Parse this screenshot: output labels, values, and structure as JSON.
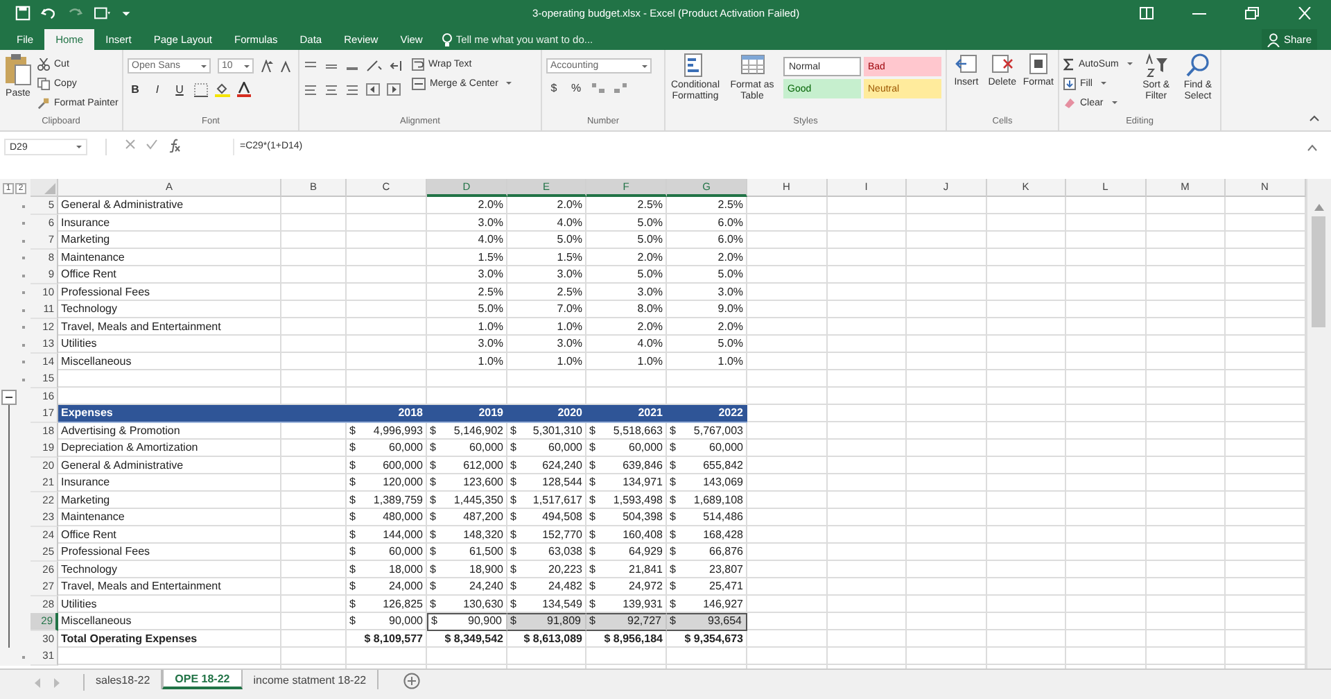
{
  "title_bar": {
    "title": "3-operating budget.xlsx - Excel (Product Activation Failed)"
  },
  "menu_tabs": [
    {
      "label": "File",
      "selected": false
    },
    {
      "label": "Home",
      "selected": true
    },
    {
      "label": "Insert",
      "selected": false
    },
    {
      "label": "Page Layout",
      "selected": false
    },
    {
      "label": "Formulas",
      "selected": false
    },
    {
      "label": "Data",
      "selected": false
    },
    {
      "label": "Review",
      "selected": false
    },
    {
      "label": "View",
      "selected": false
    }
  ],
  "tell_me": {
    "placeholder": "Tell me what you want to do..."
  },
  "share": "Share",
  "ribbon": {
    "clipboard": {
      "label": "Clipboard",
      "paste": "Paste",
      "cut": "Cut",
      "copy": "Copy",
      "format_painter": "Format Painter"
    },
    "font": {
      "label": "Font",
      "family": "Open Sans",
      "size": "10",
      "bold": "B",
      "italic": "I",
      "underline": "U"
    },
    "alignment": {
      "label": "Alignment",
      "wrap_text": "Wrap Text",
      "merge_center": "Merge & Center"
    },
    "number": {
      "label": "Number",
      "format": "Accounting",
      "currency": "$",
      "percent": "%"
    },
    "styles": {
      "label": "Styles",
      "conditional_formatting": "Conditional Formatting",
      "format_as_table": "Format as Table",
      "cell_styles": [
        {
          "label": "Normal",
          "kind": "normal"
        },
        {
          "label": "Bad",
          "kind": "bad"
        },
        {
          "label": "Good",
          "kind": "good"
        },
        {
          "label": "Neutral",
          "kind": "neutral"
        }
      ]
    },
    "cells": {
      "label": "Cells",
      "insert": "Insert",
      "delete": "Delete",
      "format": "Format"
    },
    "editing": {
      "label": "Editing",
      "autosum": "AutoSum",
      "fill": "Fill",
      "clear": "Clear",
      "sort_filter": "Sort & Filter",
      "find_select": "Find & Select"
    }
  },
  "formula_bar": {
    "name_box": "D29",
    "formula": "=C29*(1+D14)"
  },
  "outline": {
    "levels": [
      "1",
      "2"
    ],
    "expanded": true
  },
  "columns": [
    {
      "label": "A",
      "selected": false
    },
    {
      "label": "B",
      "selected": false
    },
    {
      "label": "C",
      "selected": false
    },
    {
      "label": "D",
      "selected": true
    },
    {
      "label": "E",
      "selected": true
    },
    {
      "label": "F",
      "selected": true
    },
    {
      "label": "G",
      "selected": true
    },
    {
      "label": "H",
      "selected": false
    },
    {
      "label": "I",
      "selected": false
    },
    {
      "label": "J",
      "selected": false
    },
    {
      "label": "K",
      "selected": false
    },
    {
      "label": "L",
      "selected": false
    },
    {
      "label": "M",
      "selected": false
    },
    {
      "label": "N",
      "selected": false
    }
  ],
  "rows": [
    {
      "number": "5",
      "kind": "rate",
      "grouped": false,
      "selected": false,
      "label": "General & Administrative",
      "values": [
        "2.0%",
        "2.0%",
        "2.5%",
        "2.5%"
      ]
    },
    {
      "number": "6",
      "kind": "rate",
      "grouped": false,
      "selected": false,
      "label": "Insurance",
      "values": [
        "3.0%",
        "4.0%",
        "5.0%",
        "6.0%"
      ]
    },
    {
      "number": "7",
      "kind": "rate",
      "grouped": false,
      "selected": false,
      "label": "Marketing",
      "values": [
        "4.0%",
        "5.0%",
        "5.0%",
        "6.0%"
      ]
    },
    {
      "number": "8",
      "kind": "rate",
      "grouped": false,
      "selected": false,
      "label": "Maintenance",
      "values": [
        "1.5%",
        "1.5%",
        "2.0%",
        "2.0%"
      ]
    },
    {
      "number": "9",
      "kind": "rate",
      "grouped": false,
      "selected": false,
      "label": "Office Rent",
      "values": [
        "3.0%",
        "3.0%",
        "5.0%",
        "5.0%"
      ]
    },
    {
      "number": "10",
      "kind": "rate",
      "grouped": false,
      "selected": false,
      "label": "Professional Fees",
      "values": [
        "2.5%",
        "2.5%",
        "3.0%",
        "3.0%"
      ]
    },
    {
      "number": "11",
      "kind": "rate",
      "grouped": false,
      "selected": false,
      "label": "Technology",
      "values": [
        "5.0%",
        "7.0%",
        "8.0%",
        "9.0%"
      ]
    },
    {
      "number": "12",
      "kind": "rate",
      "grouped": false,
      "selected": false,
      "label": "Travel, Meals and Entertainment",
      "values": [
        "1.0%",
        "1.0%",
        "2.0%",
        "2.0%"
      ]
    },
    {
      "number": "13",
      "kind": "rate",
      "grouped": false,
      "selected": false,
      "label": "Utilities",
      "values": [
        "3.0%",
        "3.0%",
        "4.0%",
        "5.0%"
      ]
    },
    {
      "number": "14",
      "kind": "rate",
      "grouped": false,
      "selected": false,
      "label": "Miscellaneous",
      "values": [
        "1.0%",
        "1.0%",
        "1.0%",
        "1.0%"
      ]
    },
    {
      "number": "15",
      "kind": "empty",
      "grouped": false,
      "selected": false
    },
    {
      "number": "16",
      "kind": "empty",
      "grouped": false,
      "selected": false
    },
    {
      "number": "17",
      "kind": "header",
      "grouped": true,
      "selected": false,
      "label": "Expenses",
      "values": [
        "2018",
        "2019",
        "2020",
        "2021",
        "2022"
      ]
    },
    {
      "number": "18",
      "kind": "amount",
      "grouped": true,
      "selected": false,
      "label": "Advertising & Promotion",
      "cells": [
        {
          "symbol": "$",
          "amount": "4,996,993",
          "selected": false
        },
        {
          "symbol": "$",
          "amount": "5,146,902",
          "selected": false
        },
        {
          "symbol": "$",
          "amount": "5,301,310",
          "selected": false
        },
        {
          "symbol": "$",
          "amount": "5,518,663",
          "selected": false
        },
        {
          "symbol": "$",
          "amount": "5,767,003",
          "selected": false
        }
      ]
    },
    {
      "number": "19",
      "kind": "amount",
      "grouped": true,
      "selected": false,
      "label": "Depreciation & Amortization",
      "cells": [
        {
          "symbol": "$",
          "amount": "60,000",
          "selected": false
        },
        {
          "symbol": "$",
          "amount": "60,000",
          "selected": false
        },
        {
          "symbol": "$",
          "amount": "60,000",
          "selected": false
        },
        {
          "symbol": "$",
          "amount": "60,000",
          "selected": false
        },
        {
          "symbol": "$",
          "amount": "60,000",
          "selected": false
        }
      ]
    },
    {
      "number": "20",
      "kind": "amount",
      "grouped": true,
      "selected": false,
      "label": "General & Administrative",
      "cells": [
        {
          "symbol": "$",
          "amount": "600,000",
          "selected": false
        },
        {
          "symbol": "$",
          "amount": "612,000",
          "selected": false
        },
        {
          "symbol": "$",
          "amount": "624,240",
          "selected": false
        },
        {
          "symbol": "$",
          "amount": "639,846",
          "selected": false
        },
        {
          "symbol": "$",
          "amount": "655,842",
          "selected": false
        }
      ]
    },
    {
      "number": "21",
      "kind": "amount",
      "grouped": true,
      "selected": false,
      "label": "Insurance",
      "cells": [
        {
          "symbol": "$",
          "amount": "120,000",
          "selected": false
        },
        {
          "symbol": "$",
          "amount": "123,600",
          "selected": false
        },
        {
          "symbol": "$",
          "amount": "128,544",
          "selected": false
        },
        {
          "symbol": "$",
          "amount": "134,971",
          "selected": false
        },
        {
          "symbol": "$",
          "amount": "143,069",
          "selected": false
        }
      ]
    },
    {
      "number": "22",
      "kind": "amount",
      "grouped": true,
      "selected": false,
      "label": "Marketing",
      "cells": [
        {
          "symbol": "$",
          "amount": "1,389,759",
          "selected": false
        },
        {
          "symbol": "$",
          "amount": "1,445,350",
          "selected": false
        },
        {
          "symbol": "$",
          "amount": "1,517,617",
          "selected": false
        },
        {
          "symbol": "$",
          "amount": "1,593,498",
          "selected": false
        },
        {
          "symbol": "$",
          "amount": "1,689,108",
          "selected": false
        }
      ]
    },
    {
      "number": "23",
      "kind": "amount",
      "grouped": true,
      "selected": false,
      "label": "Maintenance",
      "cells": [
        {
          "symbol": "$",
          "amount": "480,000",
          "selected": false
        },
        {
          "symbol": "$",
          "amount": "487,200",
          "selected": false
        },
        {
          "symbol": "$",
          "amount": "494,508",
          "selected": false
        },
        {
          "symbol": "$",
          "amount": "504,398",
          "selected": false
        },
        {
          "symbol": "$",
          "amount": "514,486",
          "selected": false
        }
      ]
    },
    {
      "number": "24",
      "kind": "amount",
      "grouped": true,
      "selected": false,
      "label": "Office Rent",
      "cells": [
        {
          "symbol": "$",
          "amount": "144,000",
          "selected": false
        },
        {
          "symbol": "$",
          "amount": "148,320",
          "selected": false
        },
        {
          "symbol": "$",
          "amount": "152,770",
          "selected": false
        },
        {
          "symbol": "$",
          "amount": "160,408",
          "selected": false
        },
        {
          "symbol": "$",
          "amount": "168,428",
          "selected": false
        }
      ]
    },
    {
      "number": "25",
      "kind": "amount",
      "grouped": true,
      "selected": false,
      "label": "Professional Fees",
      "cells": [
        {
          "symbol": "$",
          "amount": "60,000",
          "selected": false
        },
        {
          "symbol": "$",
          "amount": "61,500",
          "selected": false
        },
        {
          "symbol": "$",
          "amount": "63,038",
          "selected": false
        },
        {
          "symbol": "$",
          "amount": "64,929",
          "selected": false
        },
        {
          "symbol": "$",
          "amount": "66,876",
          "selected": false
        }
      ]
    },
    {
      "number": "26",
      "kind": "amount",
      "grouped": true,
      "selected": false,
      "label": "Technology",
      "cells": [
        {
          "symbol": "$",
          "amount": "18,000",
          "selected": false
        },
        {
          "symbol": "$",
          "amount": "18,900",
          "selected": false
        },
        {
          "symbol": "$",
          "amount": "20,223",
          "selected": false
        },
        {
          "symbol": "$",
          "amount": "21,841",
          "selected": false
        },
        {
          "symbol": "$",
          "amount": "23,807",
          "selected": false
        }
      ]
    },
    {
      "number": "27",
      "kind": "amount",
      "grouped": true,
      "selected": false,
      "label": "Travel, Meals and Entertainment",
      "cells": [
        {
          "symbol": "$",
          "amount": "24,000",
          "selected": false
        },
        {
          "symbol": "$",
          "amount": "24,240",
          "selected": false
        },
        {
          "symbol": "$",
          "amount": "24,482",
          "selected": false
        },
        {
          "symbol": "$",
          "amount": "24,972",
          "selected": false
        },
        {
          "symbol": "$",
          "amount": "25,471",
          "selected": false
        }
      ]
    },
    {
      "number": "28",
      "kind": "amount",
      "grouped": true,
      "selected": false,
      "label": "Utilities",
      "cells": [
        {
          "symbol": "$",
          "amount": "126,825",
          "selected": false
        },
        {
          "symbol": "$",
          "amount": "130,630",
          "selected": false
        },
        {
          "symbol": "$",
          "amount": "134,549",
          "selected": false
        },
        {
          "symbol": "$",
          "amount": "139,931",
          "selected": false
        },
        {
          "symbol": "$",
          "amount": "146,927",
          "selected": false
        }
      ]
    },
    {
      "number": "29",
      "kind": "amount",
      "grouped": true,
      "selected": true,
      "label": "Miscellaneous",
      "cells": [
        {
          "symbol": "$",
          "amount": "90,000",
          "selected": false
        },
        {
          "symbol": "$",
          "amount": "90,900",
          "selected": true
        },
        {
          "symbol": "$",
          "amount": "91,809",
          "selected": true
        },
        {
          "symbol": "$",
          "amount": "92,727",
          "selected": true
        },
        {
          "symbol": "$",
          "amount": "93,654",
          "selected": true
        }
      ]
    },
    {
      "number": "30",
      "kind": "total",
      "grouped": true,
      "selected": false,
      "label": "Total Operating Expenses",
      "values": [
        "$ 8,109,577",
        "$ 8,349,542",
        "$ 8,613,089",
        "$ 8,956,184",
        "$ 9,354,673"
      ]
    },
    {
      "number": "31",
      "kind": "empty",
      "grouped": false,
      "selected": false
    }
  ],
  "sheet_tabs": [
    {
      "label": "sales18-22",
      "selected": false
    },
    {
      "label": "OPE 18-22",
      "selected": true
    },
    {
      "label": "income statment 18-22",
      "selected": false
    }
  ]
}
